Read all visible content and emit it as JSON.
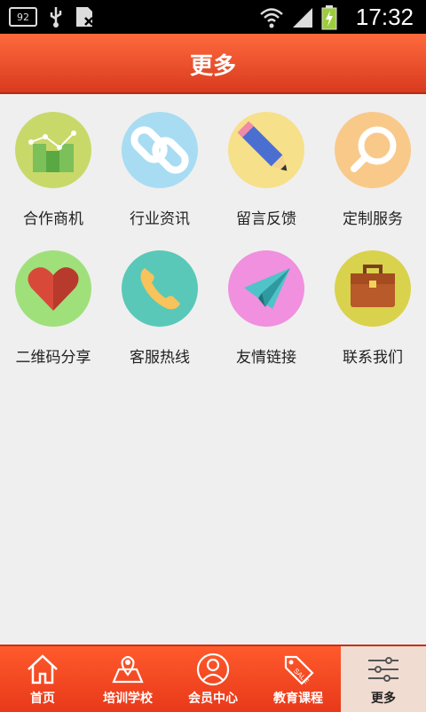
{
  "status": {
    "badge": "92",
    "time": "17:32"
  },
  "header": {
    "title": "更多"
  },
  "grid": {
    "items": [
      {
        "label": "合作商机",
        "icon": "chart-icon",
        "color": "#c8d96a"
      },
      {
        "label": "行业资讯",
        "icon": "link-icon",
        "color": "#a8dcf2"
      },
      {
        "label": "留言反馈",
        "icon": "pencil-icon",
        "color": "#f7e08a"
      },
      {
        "label": "定制服务",
        "icon": "magnifier-icon",
        "color": "#f9c98a"
      },
      {
        "label": "二维码分享",
        "icon": "heart-icon",
        "color": "#9fe07b"
      },
      {
        "label": "客服热线",
        "icon": "phone-icon",
        "color": "#59c8b8"
      },
      {
        "label": "友情链接",
        "icon": "paper-plane-icon",
        "color": "#f090de"
      },
      {
        "label": "联系我们",
        "icon": "briefcase-icon",
        "color": "#d9d24c"
      }
    ]
  },
  "tabbar": {
    "tabs": [
      {
        "label": "首页",
        "icon": "home-icon"
      },
      {
        "label": "培训学校",
        "icon": "map-icon"
      },
      {
        "label": "会员中心",
        "icon": "user-icon"
      },
      {
        "label": "教育课程",
        "icon": "sale-tag-icon"
      },
      {
        "label": "更多",
        "icon": "sliders-icon"
      }
    ],
    "active_index": 4
  }
}
